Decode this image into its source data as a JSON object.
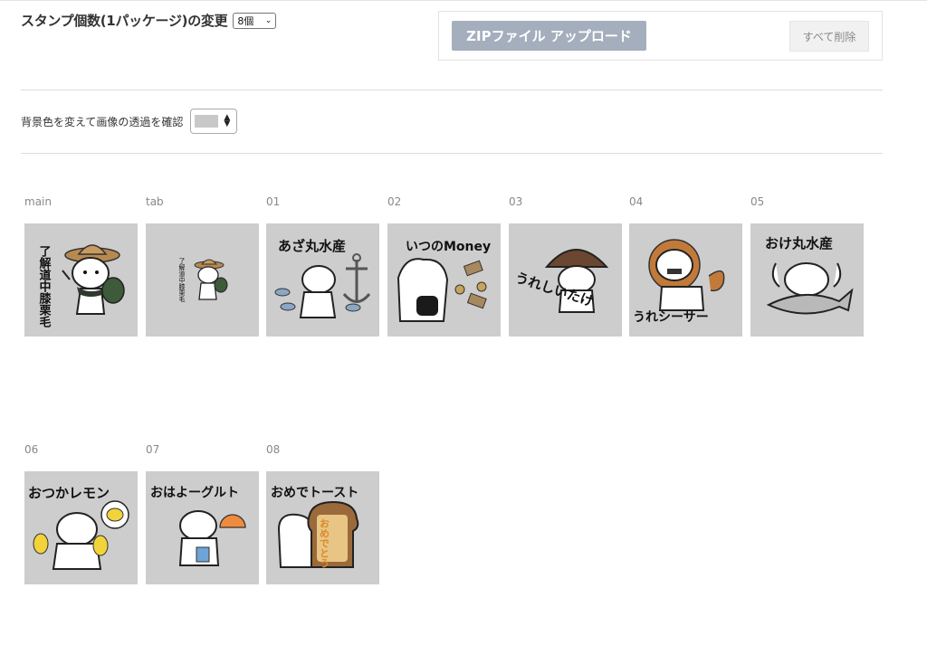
{
  "header": {
    "title": "スタンプ個数(1パッケージ)の変更",
    "count_select": "8個"
  },
  "upload": {
    "zip_button": "ZIPファイル アップロード",
    "delete_button": "すべて削除"
  },
  "background": {
    "label": "背景色を変えて画像の透過を確認",
    "selected_color": "#c8c8c8"
  },
  "stamps": [
    {
      "label": "main",
      "caption": "了解道中膝栗毛"
    },
    {
      "label": "tab",
      "caption": "了解道中膝栗毛"
    },
    {
      "label": "01",
      "caption": "あざ丸水産"
    },
    {
      "label": "02",
      "caption": "いつのMoney"
    },
    {
      "label": "03",
      "caption": "うれしいたけ"
    },
    {
      "label": "04",
      "caption": "うれシーサー"
    },
    {
      "label": "05",
      "caption": "おけ丸水産"
    },
    {
      "label": "06",
      "caption": "おつかレモン"
    },
    {
      "label": "07",
      "caption": "おはよーグルト"
    },
    {
      "label": "08",
      "caption": "おめでトースト"
    }
  ],
  "toast_text": "おめでとう",
  "colors": {
    "tile_bg": "#cdcdcd",
    "zip_button": "#a4aebd"
  }
}
